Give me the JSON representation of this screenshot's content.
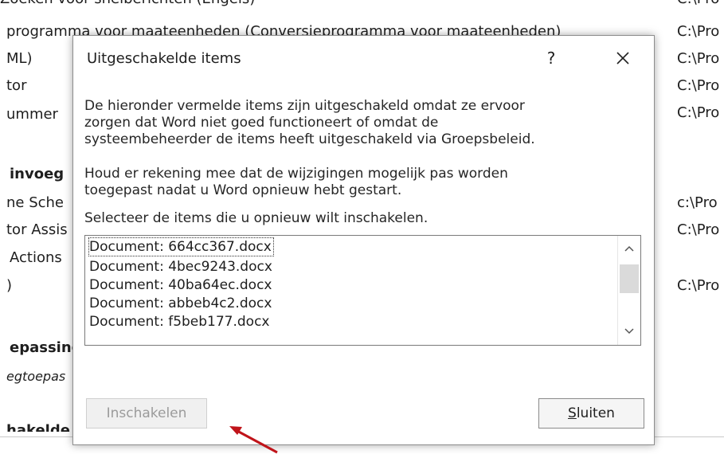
{
  "background": {
    "top_partial": "Zoeken voor snelberichten (Engels)",
    "top_partial_path": "C:\\Pro",
    "rows": [
      {
        "text": "programma voor maateenheden (Conversieprogramma voor maateenheden)",
        "path": "C:\\Pro"
      },
      {
        "text": "ML)",
        "path": "C:\\Pro"
      },
      {
        "text": "tor",
        "path": "C:\\Pro"
      },
      {
        "text": "ummer",
        "path": "C:\\Pro"
      },
      {
        "text": "invoeg",
        "path": ""
      },
      {
        "text": "ne Sche",
        "path": "c:\\Pro"
      },
      {
        "text": "tor Assis",
        "path": "C:\\Pro"
      },
      {
        "text": "Actions",
        "path": ""
      },
      {
        "text": ")",
        "path": "C:\\Pro"
      },
      {
        "text": "epassing",
        "path": ""
      },
      {
        "text": "egtoepas",
        "path": ""
      },
      {
        "text": "hakelde",
        "path": ""
      }
    ]
  },
  "dialog": {
    "title": "Uitgeschakelde items",
    "help_label": "?",
    "description_1": "De hieronder vermelde items zijn uitgeschakeld omdat ze ervoor zorgen dat Word niet goed functioneert of omdat de systeembeheerder de items heeft uitgeschakeld via Groepsbeleid.",
    "description_1_lines": [
      "De hieronder vermelde items zijn uitgeschakeld omdat ze ervoor",
      "zorgen dat Word niet goed functioneert of omdat de",
      "systeembeheerder de items heeft uitgeschakeld via Groepsbeleid."
    ],
    "description_2_lines": [
      "Houd er rekening mee dat de wijzigingen mogelijk pas worden",
      "toegepast nadat u Word opnieuw hebt gestart."
    ],
    "instruction": "Selecteer de items die u opnieuw wilt inschakelen.",
    "items": [
      "Document: 664cc367.docx",
      "Document: 4bec9243.docx",
      "Document: 40ba64ec.docx",
      "Document: abbeb4c2.docx",
      "Document: f5beb177.docx"
    ],
    "enable_button": "Inschakelen",
    "close_button_accel": "S",
    "close_button_rest": "luiten"
  },
  "colors": {
    "annotation_arrow": "#c0141a"
  }
}
